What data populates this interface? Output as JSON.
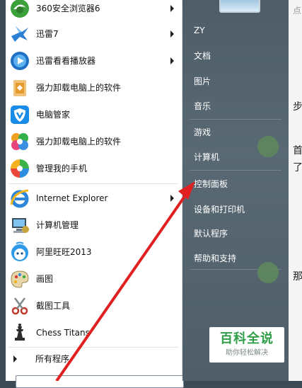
{
  "programs": [
    {
      "label": "360安全浏览器6",
      "icon": "browser-360-icon",
      "has_submenu": true
    },
    {
      "label": "迅雷7",
      "icon": "thunder-bird-icon",
      "has_submenu": true
    },
    {
      "label": "迅雷看看播放器",
      "icon": "player-icon",
      "has_submenu": true
    },
    {
      "label": "强力卸载电脑上的软件",
      "icon": "uninstall-bin-icon",
      "has_submenu": false
    },
    {
      "label": "电脑管家",
      "icon": "shield-v-icon",
      "has_submenu": false
    },
    {
      "label": "强力卸载电脑上的软件",
      "icon": "colorful-petals-icon",
      "has_submenu": false
    },
    {
      "label": "管理我的手机",
      "icon": "pinwheel-icon",
      "has_submenu": false
    },
    {
      "label": "Internet Explorer",
      "icon": "internet-explorer-icon",
      "has_submenu": true
    },
    {
      "label": "计算机管理",
      "icon": "computer-management-icon",
      "has_submenu": false
    },
    {
      "label": "阿里旺旺2013",
      "icon": "aliwangwang-icon",
      "has_submenu": false
    },
    {
      "label": "画图",
      "icon": "paint-palette-icon",
      "has_submenu": false
    },
    {
      "label": "截图工具",
      "icon": "scissors-icon",
      "has_submenu": false
    },
    {
      "label": "Chess Titans",
      "icon": "chess-icon",
      "has_submenu": false
    }
  ],
  "all_programs_label": "所有程序",
  "right_links": [
    "ZY",
    "文档",
    "图片",
    "音乐",
    "游戏",
    "计算机",
    "控制面板",
    "设备和打印机",
    "默认程序",
    "帮助和支持"
  ],
  "background_window": {
    "texts": [
      "点",
      "步",
      "首",
      "了",
      "那"
    ]
  },
  "watermark": {
    "title": "百科全说",
    "subtitle": "助你轻松解决"
  },
  "colors": {
    "accent_green": "#2f9e47",
    "arrow_red": "#e02020",
    "right_panel": "#56666f"
  }
}
